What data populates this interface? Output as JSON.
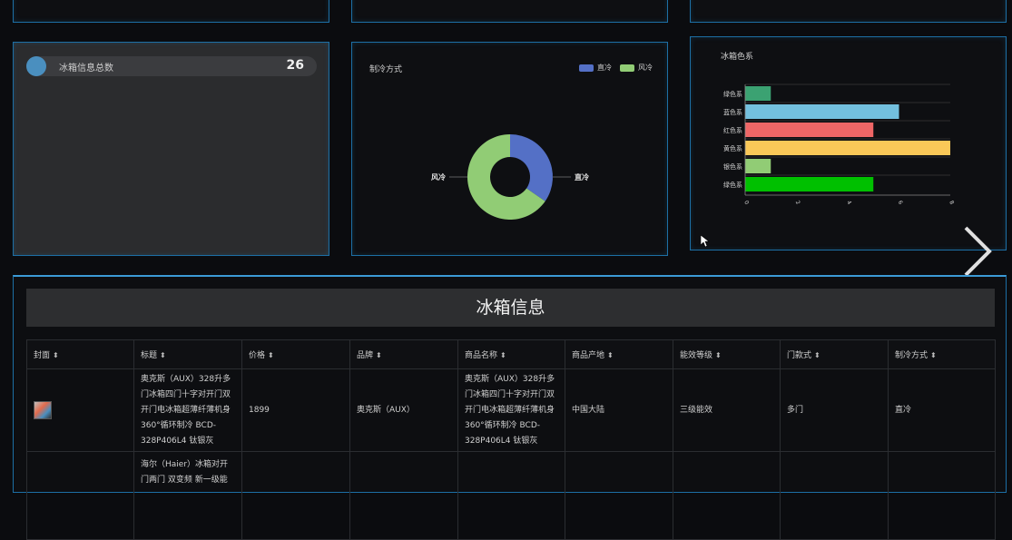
{
  "stat": {
    "label": "冰箱信息总数",
    "value": "26"
  },
  "cooling_chart_title": "制冷方式",
  "color_chart_title": "冰箱色系",
  "table_title": "冰箱信息",
  "columns": [
    "封面",
    "标题",
    "价格",
    "品牌",
    "商品名称",
    "商品产地",
    "能效等级",
    "门款式",
    "制冷方式"
  ],
  "rows": [
    {
      "cover": "",
      "title": "奥克斯（AUX）328升多门冰箱四门十字对开门双开门电冰箱超薄纤薄机身 360°循环制冷 BCD-328P406L4 钛银灰",
      "price": "1899",
      "brand": "奥克斯（AUX）",
      "name": "奥克斯（AUX）328升多门冰箱四门十字对开门双开门电冰箱超薄纤薄机身 360°循环制冷 BCD-328P406L4 钛银灰",
      "origin": "中国大陆",
      "energy": "三级能效",
      "door": "多门",
      "cooling": "直冷"
    },
    {
      "cover": "",
      "title": "海尔（Haier）冰箱对开门两门 双变频 新一级能",
      "price": "",
      "brand": "",
      "name": "",
      "origin": "",
      "energy": "",
      "door": "",
      "cooling": ""
    }
  ],
  "chart_data": [
    {
      "type": "pie",
      "title": "制冷方式",
      "categories": [
        "直冷",
        "风冷"
      ],
      "values": [
        9,
        17
      ],
      "colors": [
        "#5470c6",
        "#91cc75"
      ],
      "legend": "top-right"
    },
    {
      "type": "bar",
      "orientation": "horizontal",
      "title": "冰箱色系",
      "categories": [
        "绿色系",
        "蓝色系",
        "红色系",
        "黄色系",
        "银色系",
        "绿色系"
      ],
      "values": [
        1,
        6,
        5,
        8,
        1,
        5
      ],
      "colors": [
        "#3ba272",
        "#73c0de",
        "#ee6666",
        "#fac858",
        "#91cc75",
        "#00c000"
      ],
      "xlim": [
        0,
        8
      ],
      "xticks": [
        "0",
        "2",
        "4",
        "6",
        "8"
      ]
    }
  ]
}
